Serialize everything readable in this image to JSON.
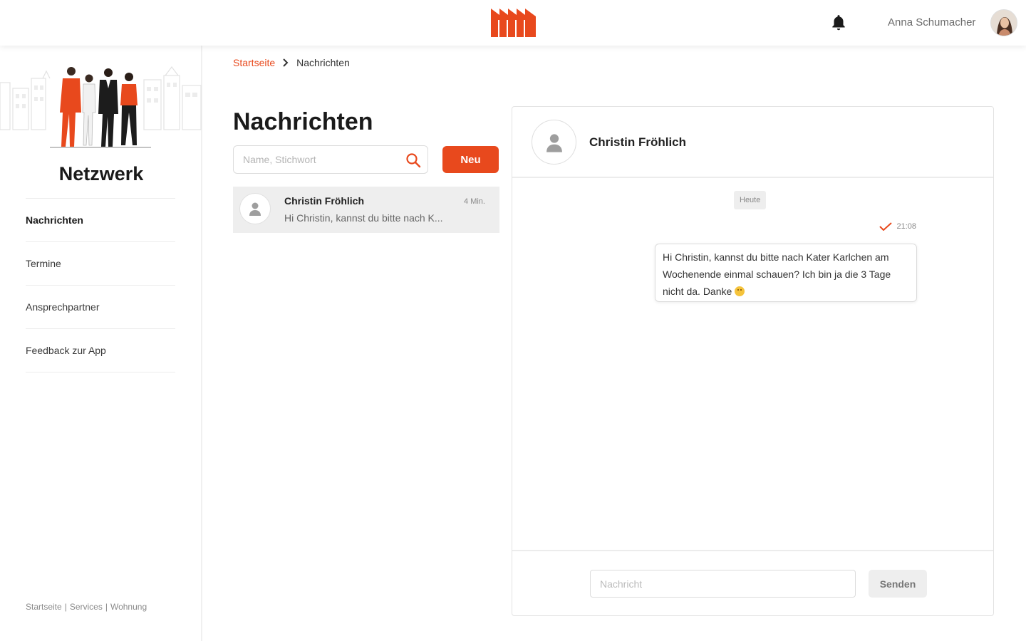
{
  "header": {
    "username": "Anna Schumacher"
  },
  "sidebar": {
    "title": "Netzwerk",
    "items": [
      {
        "label": "Nachrichten"
      },
      {
        "label": "Termine"
      },
      {
        "label": "Ansprechpartner"
      },
      {
        "label": "Feedback zur App"
      }
    ],
    "footer_links": [
      "Startseite",
      "Services",
      "Wohnung"
    ],
    "footer_separator": "|"
  },
  "breadcrumb": {
    "home": "Startseite",
    "current": "Nachrichten"
  },
  "messages": {
    "title": "Nachrichten",
    "search_placeholder": "Name, Stichwort",
    "new_button": "Neu",
    "conversations": [
      {
        "name": "Christin Fröhlich",
        "time": "4 Min.",
        "preview": "Hi Christin, kannst du bitte nach K..."
      }
    ]
  },
  "chat": {
    "contact_name": "Christin Fröhlich",
    "date_label": "Heute",
    "message_time": "21:08",
    "message_text": "Hi Christin, kannst du bitte nach Kater Karlchen am Wochenende einmal schauen? Ich bin ja die 3 Tage nicht da. Danke",
    "input_placeholder": "Nachricht",
    "send_button": "Senden"
  },
  "colors": {
    "accent": "#e8491d",
    "selected_row": "#eeeeee"
  },
  "icons": {
    "logo": "factory-roof-logo",
    "notification": "bell-icon",
    "search": "search-icon",
    "avatar_placeholder": "person-icon",
    "read_receipt": "check-icon"
  }
}
